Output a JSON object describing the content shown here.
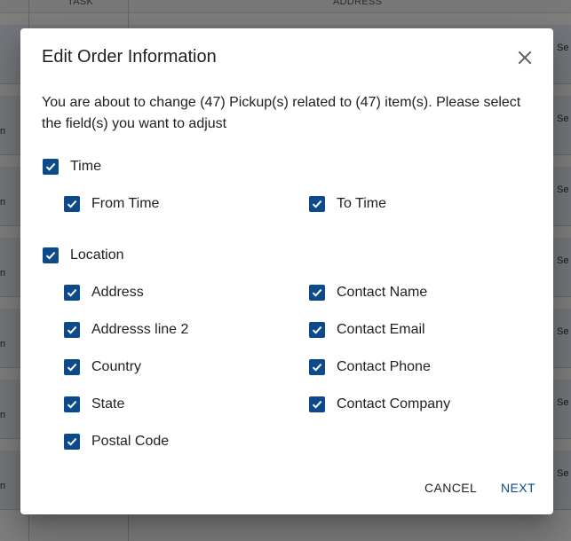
{
  "background": {
    "columns": [
      "TASK",
      "ADDRESS"
    ],
    "row_fragments": [
      "Se",
      "n"
    ]
  },
  "dialog": {
    "title": "Edit Order Information",
    "close_icon": "close-icon",
    "description": "You are about to change (47) Pickup(s) related to (47) item(s). Please select the field(s) you want to adjust",
    "time": {
      "label": "Time",
      "checked": true,
      "from_time": {
        "label": "From Time",
        "checked": true
      },
      "to_time": {
        "label": "To Time",
        "checked": true
      }
    },
    "location": {
      "label": "Location",
      "checked": true,
      "address": {
        "label": "Address",
        "checked": true
      },
      "address_line_2": {
        "label": "Addresss line 2",
        "checked": true
      },
      "country": {
        "label": "Country",
        "checked": true
      },
      "state": {
        "label": "State",
        "checked": true
      },
      "postal_code": {
        "label": "Postal Code",
        "checked": true
      },
      "contact_name": {
        "label": "Contact Name",
        "checked": true
      },
      "contact_email": {
        "label": "Contact Email",
        "checked": true
      },
      "contact_phone": {
        "label": "Contact Phone",
        "checked": true
      },
      "contact_company": {
        "label": "Contact Company",
        "checked": true
      }
    },
    "actions": {
      "cancel_label": "CANCEL",
      "next_label": "NEXT"
    }
  },
  "colors": {
    "accent": "#0d4a8c",
    "overlay": "rgba(0,0,0,0.5)"
  }
}
